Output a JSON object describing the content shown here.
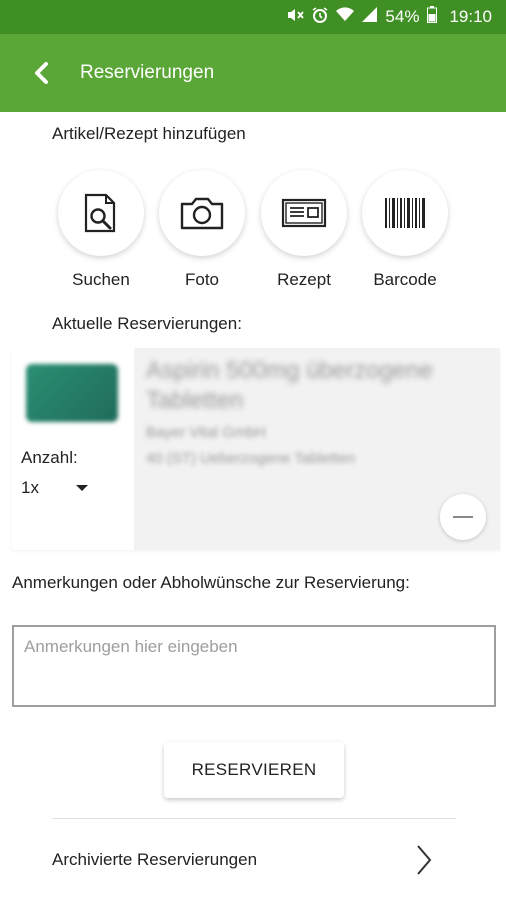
{
  "status_bar": {
    "battery": "54%",
    "time": "19:10",
    "icons": [
      "mute-icon",
      "alarm-icon",
      "wifi-icon",
      "signal-icon",
      "battery-icon"
    ]
  },
  "app_bar": {
    "title": "Reservierungen",
    "back_icon": "chevron-left-icon",
    "color": "#5aa637",
    "status_color": "#3f8f25"
  },
  "add_section": {
    "label": "Artikel/Rezept hinzufügen",
    "actions": [
      {
        "label": "Suchen",
        "icon": "document-search-icon"
      },
      {
        "label": "Foto",
        "icon": "camera-icon"
      },
      {
        "label": "Rezept",
        "icon": "prescription-icon"
      },
      {
        "label": "Barcode",
        "icon": "barcode-icon"
      }
    ]
  },
  "current_section": {
    "label": "Aktuelle Reservierungen:",
    "items": [
      {
        "title": "Aspirin 500mg überzogene Tabletten",
        "manufacturer": "Bayer Vital GmbH",
        "package": "40 (ST) Ueberzogene Tabletten",
        "qty_label": "Anzahl:",
        "qty_value": "1x",
        "remove_icon": "minus-icon"
      }
    ]
  },
  "notes": {
    "label": "Anmerkungen oder Abholwünsche zur Reservierung:",
    "placeholder": "Anmerkungen hier eingeben",
    "value": ""
  },
  "reserve_button": "RESERVIEREN",
  "archive": {
    "label": "Archivierte Reservierungen",
    "icon": "chevron-right-icon"
  }
}
